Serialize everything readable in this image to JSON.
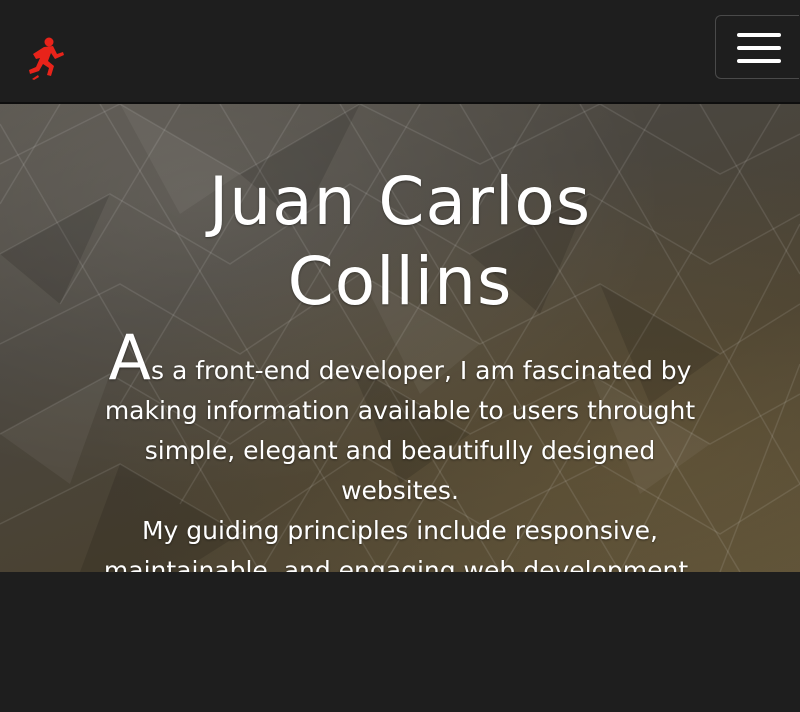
{
  "navbar": {
    "logo_icon": "running-man-icon",
    "logo_color": "#e8231a",
    "menu_icon": "hamburger-menu-icon"
  },
  "hero": {
    "title": "Juan Carlos Collins",
    "bio_drop_cap": "A",
    "bio_line1_rest": "s a front-end developer, I am fascinated by",
    "bio_line2": "making information available to users throught",
    "bio_line3": "simple, elegant and beautifully designed",
    "bio_line4": "websites.",
    "bio_line5": "My guiding principles include responsive,",
    "bio_line6": "maintainable, and engaging web development."
  },
  "colors": {
    "background": "#1e1e1e",
    "text": "#ffffff",
    "accent": "#e8231a"
  }
}
